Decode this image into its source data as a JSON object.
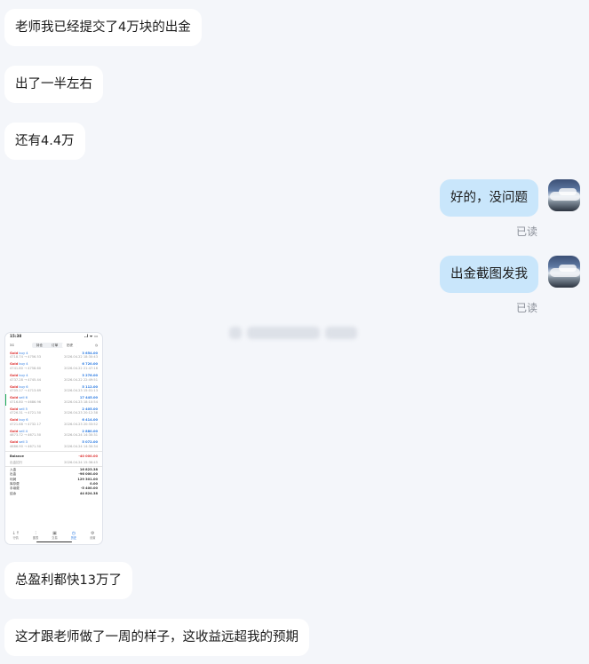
{
  "messages": {
    "m1": "老师我已经提交了4万块的出金",
    "m2": "出了一半左右",
    "m3": "还有4.4万",
    "m4": "好的，没问题",
    "m5": "出金截图发我",
    "m6": "总盈利都快13万了",
    "m7": "这才跟老师做了一周的样子，这收益远超我的预期"
  },
  "read_label": "已读",
  "screenshot": {
    "time": "15:38",
    "signal": "..l ᯤ ▭",
    "back": "3↕",
    "tabs": [
      "持仓",
      "订单",
      "历史"
    ],
    "clock_icon": "clock-icon",
    "trades": [
      {
        "side_a": "Gold",
        "side_b": "buy 4",
        "prices": "4718.74 → 4756.53",
        "amount": "3 654.00",
        "date": "2026.04.22 18:30:43",
        "hl": false
      },
      {
        "side_a": "Gold",
        "side_b": "buy 4",
        "prices": "4741.80 → 4758.60",
        "amount": "6 720.00",
        "date": "2026.04.22 21:47:16",
        "hl": false
      },
      {
        "side_a": "Gold",
        "side_b": "buy 4",
        "prices": "4737.28 → 4745.44",
        "amount": "3 276.00",
        "date": "2026.04.22 22:49:51",
        "hl": false
      },
      {
        "side_a": "Gold",
        "side_b": "buy 6",
        "prices": "4705.17 → 4713.69",
        "amount": "5 112.00",
        "date": "2026.04.23 15:01:13",
        "hl": false
      },
      {
        "side_a": "Gold",
        "side_b": "sell 6",
        "prices": "4716.80 → 4686.96",
        "amount": "17 445.00",
        "date": "2026.04.23 18:10:54",
        "hl": true
      },
      {
        "side_a": "Gold",
        "side_b": "sell 5",
        "prices": "4726.31 → 4721.50",
        "amount": "2 405.00",
        "date": "2026.04.23 20:12:38",
        "hl": false
      },
      {
        "side_a": "Gold",
        "side_b": "buy 6",
        "prices": "4721.68 → 4732.17",
        "amount": "6 414.00",
        "date": "2026.04.23 20:33:52",
        "hl": false
      },
      {
        "side_a": "Gold",
        "side_b": "sell 4",
        "prices": "4673.72 → 4671.50",
        "amount": "2 880.00",
        "date": "2026.04.24 14:30:31",
        "hl": false
      },
      {
        "side_a": "Gold",
        "side_b": "sell 3",
        "prices": "4686.90 → 4671.50",
        "amount": "5 072.00",
        "date": "2026.04.24 14:30:34",
        "hl": false
      }
    ],
    "balance": {
      "label": "Balance",
      "value": "-40 000.00",
      "sub": "出金招行",
      "date": "2026.04.24 15:36:45"
    },
    "summary": [
      {
        "k": "入金",
        "v": "16 823.38"
      },
      {
        "k": "出金",
        "v": "-96 000.00"
      },
      {
        "k": "利润",
        "v": "129 301.00"
      },
      {
        "k": "库存费",
        "v": "0.00"
      },
      {
        "k": "手续费",
        "v": "-5 400.00"
      },
      {
        "k": "结余",
        "v": "44 824.38"
      }
    ],
    "nav": [
      {
        "icon": "↓↑",
        "label": "行情"
      },
      {
        "icon": "⫶",
        "label": "图表"
      },
      {
        "icon": "▣",
        "label": "交易"
      },
      {
        "icon": "◷",
        "label": "历史"
      },
      {
        "icon": "⚙",
        "label": "设置"
      }
    ]
  }
}
